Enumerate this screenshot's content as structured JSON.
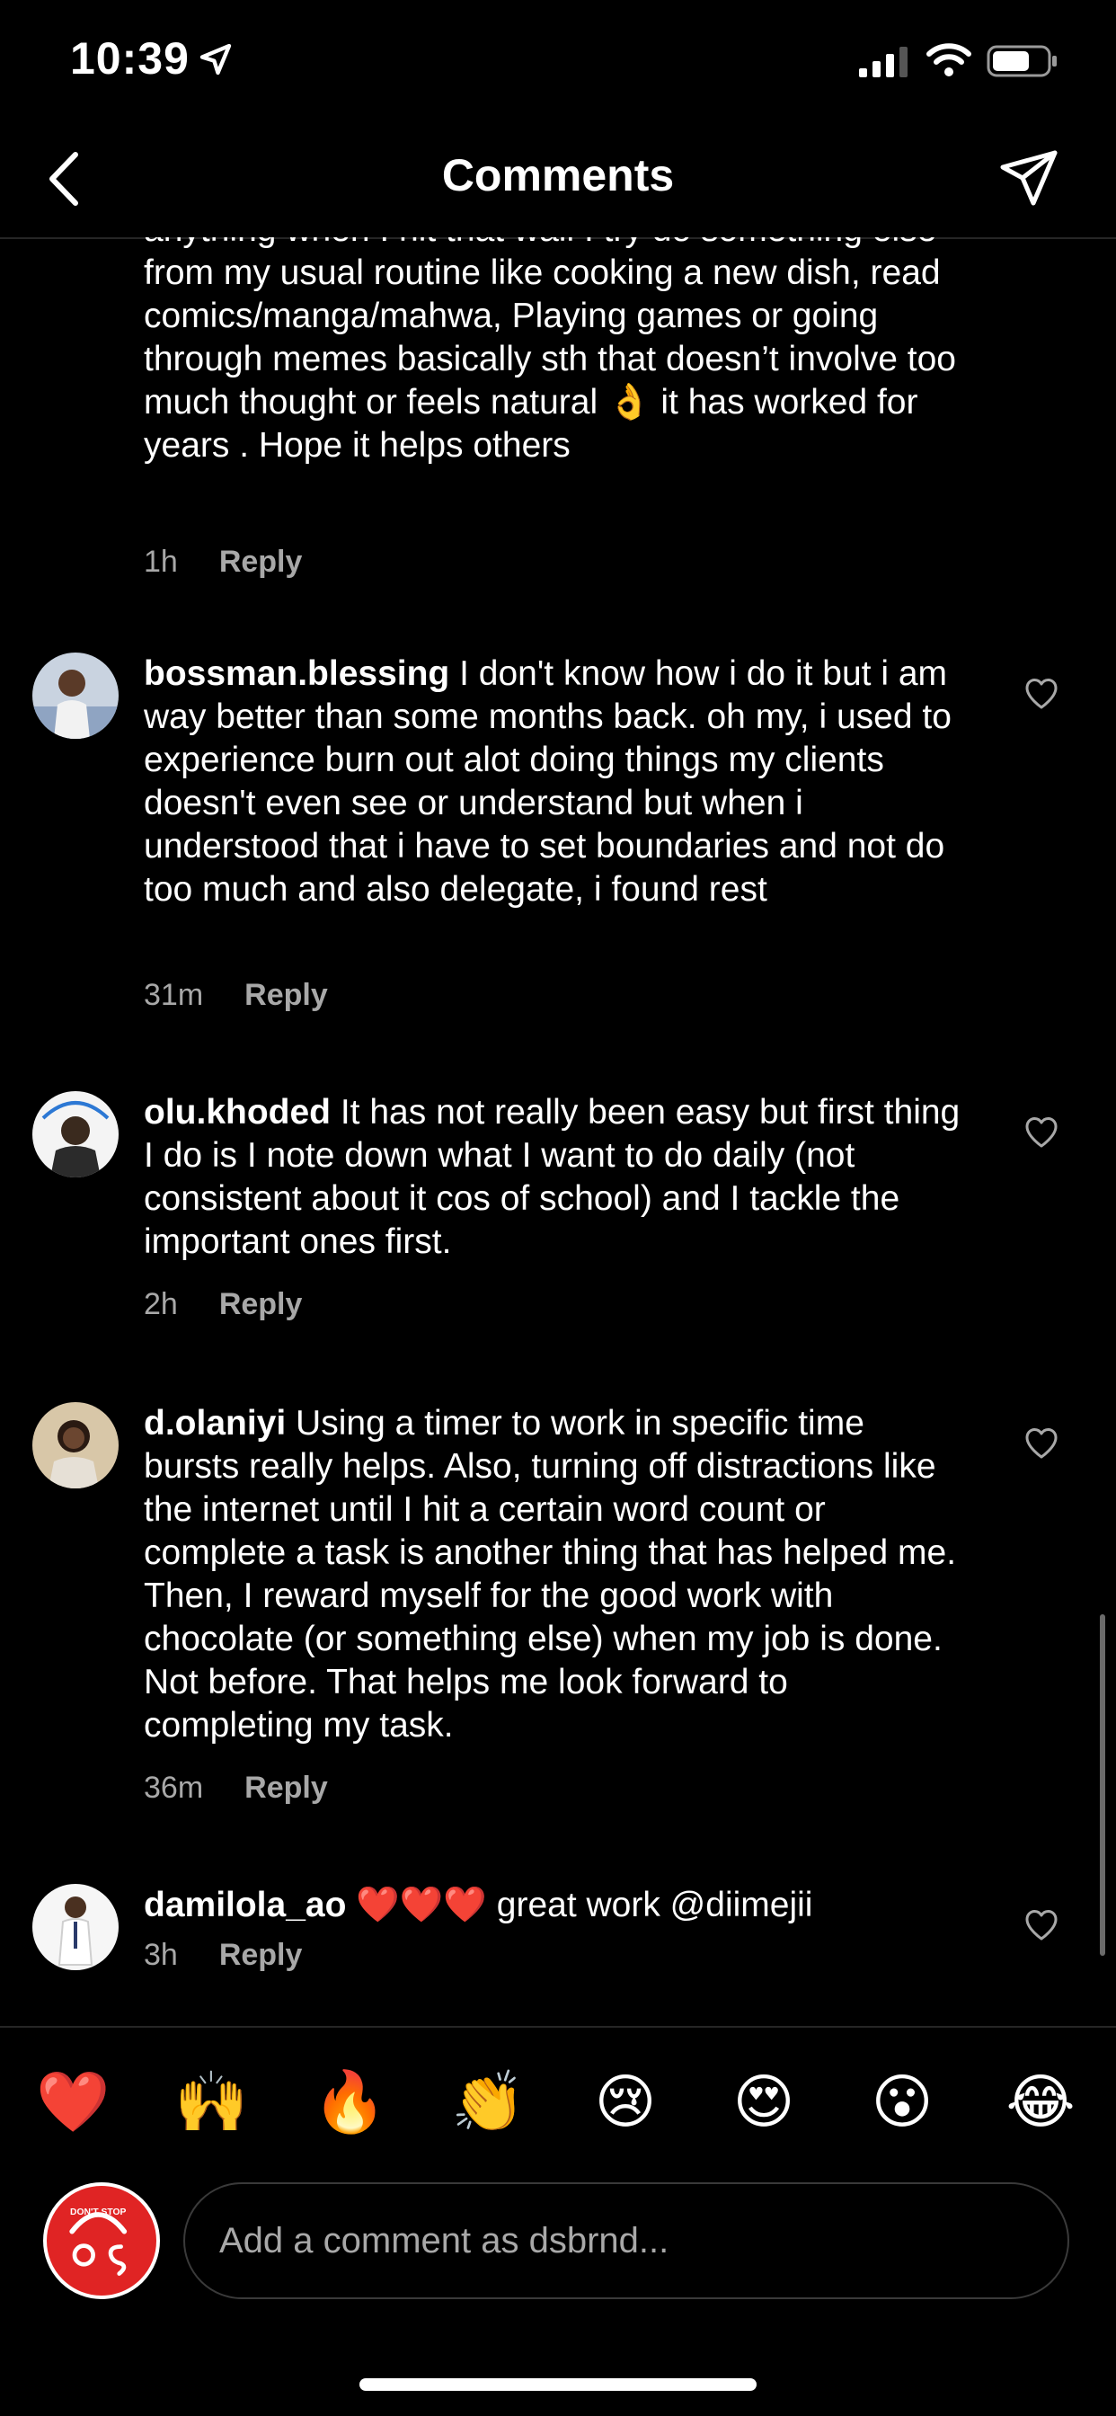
{
  "status_bar": {
    "time": "10:39"
  },
  "header": {
    "title": "Comments"
  },
  "comments": [
    {
      "username": "",
      "text": "anything when I hit that wall I try do something else from my usual routine like cooking a new dish, read comics/manga/mahwa, Playing games or going through memes basically sth that doesn’t involve too much thought or feels natural 👌 it has worked for years . Hope it helps others",
      "time": "1h",
      "reply": "Reply"
    },
    {
      "username": "bossman.blessing",
      "text": "I don't know how i do it but i am way better than some months back. oh my, i used to experience burn out alot doing things my clients doesn't even see or understand but when i understood that i have to set boundaries and not do too much and also delegate, i found rest",
      "time": "31m",
      "reply": "Reply"
    },
    {
      "username": "olu.khoded",
      "text": "It has not really been easy but first thing I do is I note down what I want to do daily (not consistent about it cos of school) and  I tackle the important ones first.",
      "time": "2h",
      "reply": "Reply"
    },
    {
      "username": "d.olaniyi",
      "text": "Using a timer to work in specific time bursts really helps. Also, turning off distractions like the internet until I hit a certain word count or complete a task is another thing that has helped me. Then, I reward myself for the good work with chocolate (or something else) when my job is done. Not before. That helps me look forward to completing my task.",
      "time": "36m",
      "reply": "Reply"
    },
    {
      "username": "damilola_ao",
      "text": "❤️❤️❤️ great work @diimejii",
      "time": "3h",
      "reply": "Reply"
    }
  ],
  "emoji_bar": [
    "❤️",
    "🙌",
    "🔥",
    "👏",
    "😢",
    "😍",
    "😮",
    "😂"
  ],
  "compose": {
    "placeholder": "Add a comment as dsbrnd...",
    "avatar_text": "DON'T STOP"
  },
  "colors": {
    "background": "#000000",
    "secondary_text": "#a8a8a8",
    "divider": "#262626",
    "accent_avatar": "#e02424"
  },
  "icons": [
    "location-arrow-icon",
    "signal-icon",
    "wifi-icon",
    "battery-icon",
    "back-chevron-icon",
    "paper-plane-icon",
    "heart-outline-icon"
  ]
}
